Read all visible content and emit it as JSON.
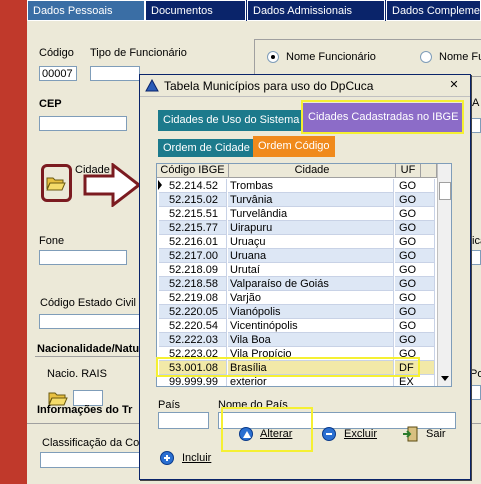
{
  "top_tabs": [
    "Dados Pessoais",
    "Documentos",
    "Dados Admissionais",
    "Dados Complemen"
  ],
  "form": {
    "codigo_label": "Código",
    "codigo_value": "00007",
    "tipo_label": "Tipo de Funcionário",
    "radio_nome_funcionario": "Nome Funcionário",
    "radio_nome_2": "Nome Fu",
    "cep_label": "CEP",
    "cidade_label": "Cidade",
    "fone_label": "Fone",
    "ica_label": "ica",
    "estado_civil_label": "Código Estado Civil",
    "nacionalidade_label": "Nacionalidade/Natu",
    "nacio_rais_label": "Nacio. RAIS",
    "por_label": "Por",
    "informacoes_label": "Informações do Tr",
    "classificacao_label": "Classificação da Co",
    "a_label": "A"
  },
  "dialog": {
    "title": "Tabela Municípios para uso do DpCuca",
    "close_glyph": "✕",
    "tab_cidades_uso": "Cidades de Uso do Sistema",
    "tab_cidades_ibge": "Cidades Cadastradas no IBGE",
    "tab_ordem_cidade": "Ordem de Cidade",
    "tab_ordem_codigo": "Ordem Código",
    "columns": [
      "Código IBGE",
      "Cidade",
      "UF"
    ],
    "rows": [
      {
        "code": "52.214.52",
        "city": "Trombas",
        "uf": "GO"
      },
      {
        "code": "52.215.02",
        "city": "Turvânia",
        "uf": "GO"
      },
      {
        "code": "52.215.51",
        "city": "Turvelândia",
        "uf": "GO"
      },
      {
        "code": "52.215.77",
        "city": "Uirapuru",
        "uf": "GO"
      },
      {
        "code": "52.216.01",
        "city": "Uruaçu",
        "uf": "GO"
      },
      {
        "code": "52.217.00",
        "city": "Uruana",
        "uf": "GO"
      },
      {
        "code": "52.218.09",
        "city": "Urutaí",
        "uf": "GO"
      },
      {
        "code": "52.218.58",
        "city": "Valparaíso de Goiás",
        "uf": "GO"
      },
      {
        "code": "52.219.08",
        "city": "Varjão",
        "uf": "GO"
      },
      {
        "code": "52.220.05",
        "city": "Vianópolis",
        "uf": "GO"
      },
      {
        "code": "52.220.54",
        "city": "Vicentinópolis",
        "uf": "GO"
      },
      {
        "code": "52.222.03",
        "city": "Vila Boa",
        "uf": "GO"
      },
      {
        "code": "52.223.02",
        "city": "Vila Propício",
        "uf": "GO"
      },
      {
        "code": "53.001.08",
        "city": "Brasília",
        "uf": "DF"
      },
      {
        "code": "99.999.99",
        "city": "exterior",
        "uf": "EX"
      }
    ],
    "pais_label": "País",
    "nome_pais_label": "Nome do País",
    "btn_incluir": "Incluir",
    "btn_alterar": "Alterar",
    "btn_excluir": "Excluir",
    "btn_sair": "Sair"
  },
  "colors": {
    "highlight": "#f5f032",
    "dark_red": "#7b1b20",
    "tab_teal": "#1c7a8c",
    "tab_orange": "#f08a1c",
    "tab_purple": "#8c6cc8",
    "title_blue": "#0a246a"
  }
}
